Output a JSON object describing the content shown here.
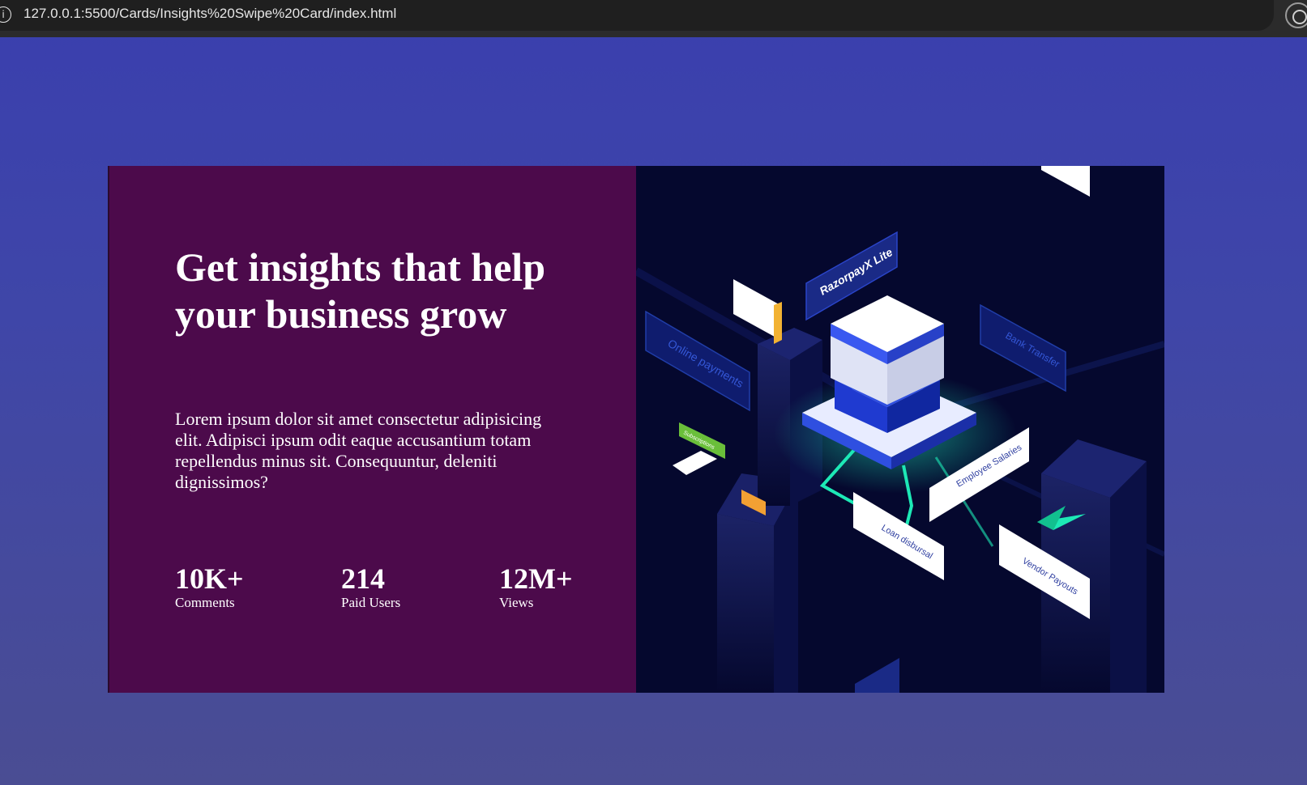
{
  "browser": {
    "url": "127.0.0.1:5500/Cards/Insights%20Swipe%20Card/index.html"
  },
  "card": {
    "headline": "Get insights that help your business grow",
    "body": "Lorem ipsum dolor sit amet consectetur adipisicing elit. Adipisci ipsum odit eaque accusantium totam repellendus minus sit. Consequuntur, deleniti dignissimos?",
    "stats": [
      {
        "value": "10K+",
        "label": "Comments"
      },
      {
        "value": "214",
        "label": "Paid Users"
      },
      {
        "value": "12M+",
        "label": "Views"
      }
    ],
    "illustration": {
      "labels": {
        "razorpay": "RazorpayX Lite",
        "online_payments": "Online payments",
        "bank_transfer": "Bank Transfer",
        "subscriptions": "Subscriptions",
        "employee_salaries": "Employee Salaries",
        "loan_disbursal": "Loan disbursal",
        "vendor_payouts": "Vendor Payouts"
      }
    }
  },
  "colors": {
    "page_bg": "#3f46a8",
    "card_left_bg": "#4c0a4b",
    "card_right_bg": "#05082e",
    "accent_green": "#1de9b6"
  }
}
